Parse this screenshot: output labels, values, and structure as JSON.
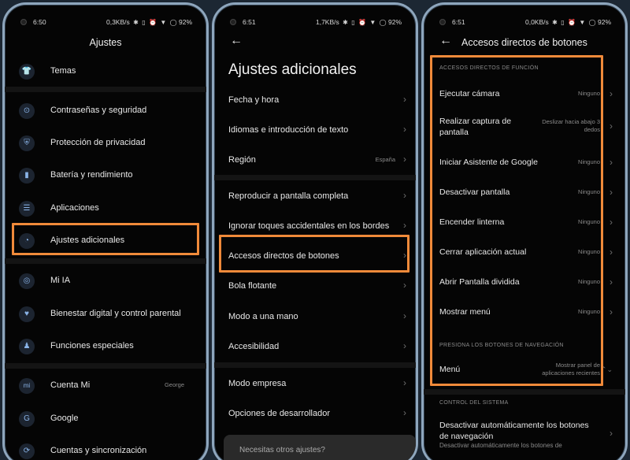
{
  "colors": {
    "accent": "#f08a3a",
    "background": "#050505",
    "icon_tint": "#8ab4e8"
  },
  "screen1": {
    "status": {
      "time": "6:50",
      "speed": "0,3KB/s",
      "battery": "92",
      "battery_unit": "%"
    },
    "title": "Ajustes",
    "items": [
      {
        "icon": "shirt-icon",
        "glyph": "👕",
        "label": "Temas"
      },
      {
        "icon": "lock-icon",
        "glyph": "⊙",
        "label": "Contraseñas y seguridad"
      },
      {
        "icon": "shield-icon",
        "glyph": "⛨",
        "label": "Protección de privacidad"
      },
      {
        "icon": "battery-icon",
        "glyph": "▮",
        "label": "Batería y rendimiento"
      },
      {
        "icon": "apps-icon",
        "glyph": "☰",
        "label": "Aplicaciones"
      },
      {
        "icon": "settings-dial-icon",
        "glyph": "◔",
        "label": "Ajustes adicionales"
      },
      {
        "icon": "ai-icon",
        "glyph": "◎",
        "label": "Mi IA"
      },
      {
        "icon": "wellbeing-icon",
        "glyph": "♥",
        "label": "Bienestar digital y control parental"
      },
      {
        "icon": "flask-icon",
        "glyph": "♟",
        "label": "Funciones especiales"
      },
      {
        "icon": "mi-icon",
        "glyph": "mi",
        "label": "Cuenta Mi",
        "value": "George"
      },
      {
        "icon": "google-icon",
        "glyph": "G",
        "label": "Google"
      },
      {
        "icon": "sync-icon",
        "glyph": "⟳",
        "label": "Cuentas y sincronización"
      }
    ]
  },
  "screen2": {
    "status": {
      "time": "6:51",
      "speed": "1,7KB/s",
      "battery": "92",
      "battery_unit": "%"
    },
    "title": "Ajustes adicionales",
    "items": [
      {
        "label": "Fecha y hora"
      },
      {
        "label": "Idiomas e introducción de texto"
      },
      {
        "label": "Región",
        "value": "España"
      },
      {
        "label": "Reproducir a pantalla completa"
      },
      {
        "label": "Ignorar toques accidentales en los bordes"
      },
      {
        "label": "Accesos directos de botones"
      },
      {
        "label": "Bola flotante"
      },
      {
        "label": "Modo a una mano"
      },
      {
        "label": "Accesibilidad"
      },
      {
        "label": "Modo empresa"
      },
      {
        "label": "Opciones de desarrollador"
      }
    ],
    "bottom_text": "Necesitas otros ajustes?"
  },
  "screen3": {
    "status": {
      "time": "6:51",
      "speed": "0,0KB/s",
      "battery": "92",
      "battery_unit": "%"
    },
    "title": "Accesos directos de botones",
    "section1": "ACCESOS DIRECTOS DE FUNCIÓN",
    "items": [
      {
        "label": "Ejecutar cámara",
        "value": "Ninguno"
      },
      {
        "label": "Realizar captura de pantalla",
        "value": "Deslizar hacia abajo 3 dedos"
      },
      {
        "label": "Iniciar Asistente de Google",
        "value": "Ninguno"
      },
      {
        "label": "Desactivar pantalla",
        "value": "Ninguno"
      },
      {
        "label": "Encender linterna",
        "value": "Ninguno"
      },
      {
        "label": "Cerrar aplicación actual",
        "value": "Ninguno"
      },
      {
        "label": "Abrir Pantalla dividida",
        "value": "Ninguno"
      },
      {
        "label": "Mostrar menú",
        "value": "Ninguno"
      }
    ],
    "section2": "PRESIONA LOS BOTONES DE NAVEGACIÓN",
    "menu": {
      "label": "Menú",
      "value": "Mostrar panel de aplicaciones recientes"
    },
    "section3": "CONTROL DEL SISTEMA",
    "auto_disable": {
      "label": "Desactivar automáticamente los botones de navegación",
      "sub": "Desactivar automáticamente los botones de"
    }
  }
}
